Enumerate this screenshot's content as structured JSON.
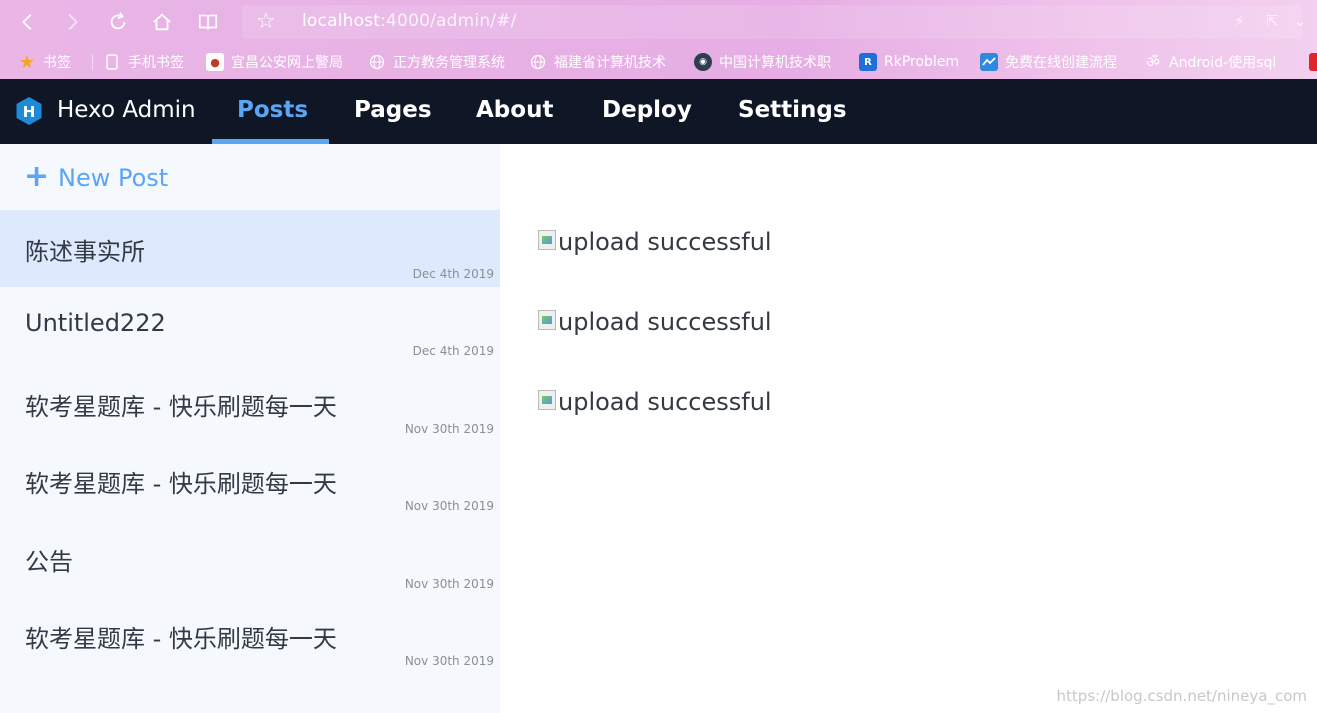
{
  "browser": {
    "url_host": "localhost",
    "url_path": ":4000/admin/#/",
    "bookmarks": [
      {
        "label": "书签",
        "icon": "star-icon"
      },
      {
        "label": "手机书签",
        "icon": "phone-icon"
      },
      {
        "label": "宜昌公安网上警局",
        "icon": "police-badge-icon"
      },
      {
        "label": "正方教务管理系统",
        "icon": "globe-icon"
      },
      {
        "label": "福建省计算机技术",
        "icon": "globe-icon"
      },
      {
        "label": "中国计算机技术职",
        "icon": "site-logo-icon"
      },
      {
        "label": "RkProblem",
        "icon": "rk-logo-icon"
      },
      {
        "label": "免费在线创建流程",
        "icon": "flow-icon"
      },
      {
        "label": "Android-使用sql",
        "icon": "android-icon"
      }
    ]
  },
  "header": {
    "logo_letter": "H",
    "app_name": "Hexo Admin",
    "tabs": [
      {
        "label": "Posts",
        "active": true
      },
      {
        "label": "Pages",
        "active": false
      },
      {
        "label": "About",
        "active": false
      },
      {
        "label": "Deploy",
        "active": false
      },
      {
        "label": "Settings",
        "active": false
      }
    ]
  },
  "sidebar": {
    "new_post_icon": "+",
    "new_post_label": "New Post",
    "posts": [
      {
        "title": "陈述事实所",
        "date": "Dec 4th 2019",
        "selected": true
      },
      {
        "title": "Untitled222",
        "date": "Dec 4th 2019",
        "selected": false
      },
      {
        "title": "软考星题库 - 快乐刷题每一天",
        "date": "Nov 30th 2019",
        "selected": false
      },
      {
        "title": "软考星题库 - 快乐刷题每一天",
        "date": "Nov 30th 2019",
        "selected": false
      },
      {
        "title": "公告",
        "date": "Nov 30th 2019",
        "selected": false
      },
      {
        "title": "软考星题库 - 快乐刷题每一天",
        "date": "Nov 30th 2019",
        "selected": false
      }
    ]
  },
  "main": {
    "images": [
      {
        "alt": "upload successful"
      },
      {
        "alt": "upload successful"
      },
      {
        "alt": "upload successful"
      }
    ]
  },
  "watermark": "https://blog.csdn.net/nineya_com",
  "colors": {
    "accent": "#5aa6f5",
    "header_bg": "#0f1727",
    "sidebar_bg": "#f5f9fe",
    "selected_bg": "#ddeafd"
  }
}
